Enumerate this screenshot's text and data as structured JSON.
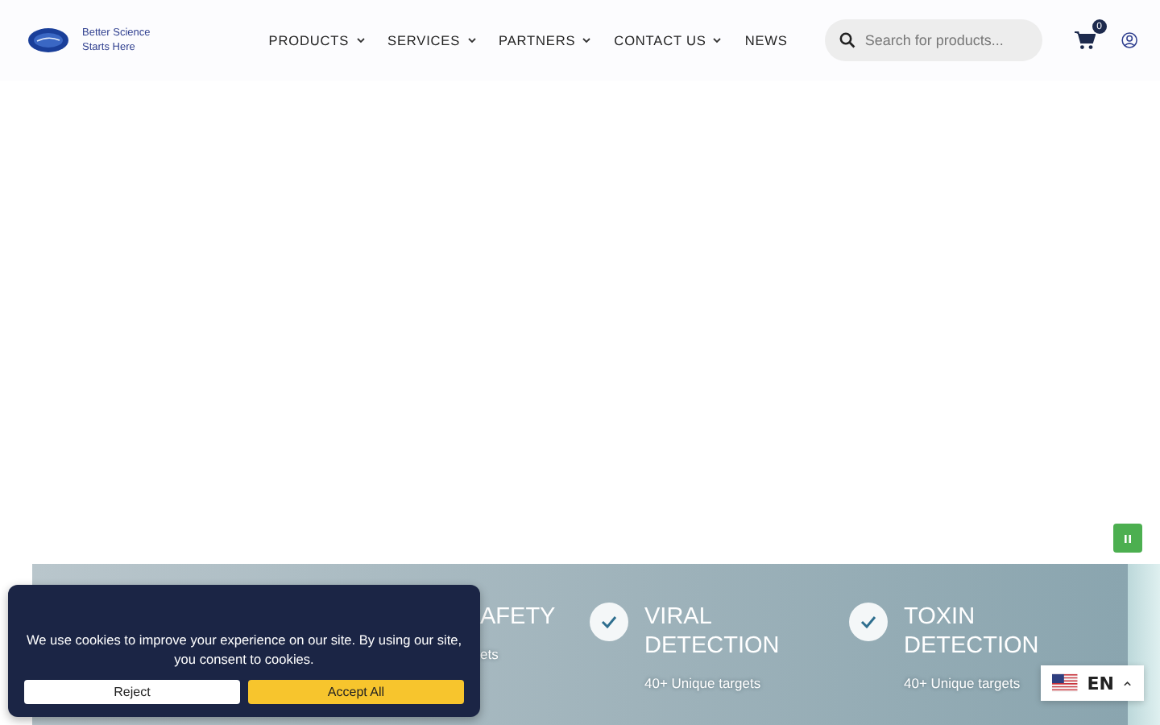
{
  "header": {
    "tagline": [
      "Better Science",
      "Starts Here"
    ],
    "nav": [
      {
        "label": "PRODUCTS",
        "has_dropdown": true
      },
      {
        "label": "SERVICES",
        "has_dropdown": true
      },
      {
        "label": "PARTNERS",
        "has_dropdown": true
      },
      {
        "label": "CONTACT US",
        "has_dropdown": true
      },
      {
        "label": "NEWS",
        "has_dropdown": false
      }
    ],
    "search": {
      "placeholder": "Search for products..."
    },
    "cart_count": "0"
  },
  "features": [
    {
      "title": "AFETY",
      "subtitle": "ets",
      "check": false
    },
    {
      "title": "VIRAL DETECTION",
      "subtitle": "40+ Unique targets",
      "check": true
    },
    {
      "title": "TOXIN DETECTION",
      "subtitle": "40+ Unique targets",
      "check": true
    }
  ],
  "cookie_banner": {
    "message": "We use cookies to improve your experience on our site. By using our site, you consent to cookies.",
    "buttons": [
      {
        "label": "Reject",
        "kind": "secondary"
      },
      {
        "label": "Accept All",
        "kind": "primary"
      }
    ]
  },
  "language": {
    "code": "EN"
  }
}
